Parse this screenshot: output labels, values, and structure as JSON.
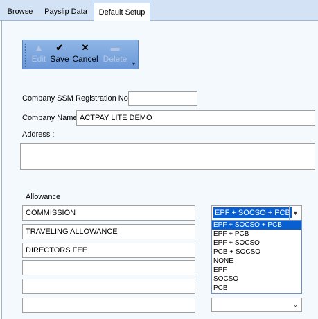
{
  "tabs": [
    {
      "label": "Browse"
    },
    {
      "label": "Payslip Data"
    },
    {
      "label": "Default Setup"
    }
  ],
  "toolbar": {
    "edit": {
      "icon": "▲",
      "label": "Edit"
    },
    "save": {
      "icon": "✔",
      "label": "Save"
    },
    "cancel": {
      "icon": "✕",
      "label": "Cancel"
    },
    "delete": {
      "icon": "▬",
      "label": "Delete"
    },
    "more": "▾"
  },
  "form": {
    "ssm_label": "Company SSM Registration No.",
    "ssm_value": "",
    "name_label": "Company Name",
    "name_value": "ACTPAY LITE DEMO",
    "address_label": "Address :",
    "address_value": ""
  },
  "allowance": {
    "title": "Allowance",
    "rows": [
      {
        "name": "COMMISSION",
        "type": "EPF + SOCSO + PCB"
      },
      {
        "name": "TRAVELING ALLOWANCE",
        "type": ""
      },
      {
        "name": "DIRECTORS FEE",
        "type": ""
      },
      {
        "name": "",
        "type": ""
      },
      {
        "name": "",
        "type": ""
      },
      {
        "name": "",
        "type": ""
      }
    ]
  },
  "dropdown": {
    "options": [
      "EPF + SOCSO + PCB",
      "EPF + PCB",
      "EPF + SOCSO",
      "PCB + SOCSO",
      "NONE",
      "EPF",
      "SOCSO",
      "PCB"
    ],
    "highlighted": "EPF + SOCSO + PCB"
  },
  "colors": {
    "selection": "#0a5fd0",
    "toolbar": "#7ea8e0",
    "tabbar": "#d4e2f5"
  }
}
